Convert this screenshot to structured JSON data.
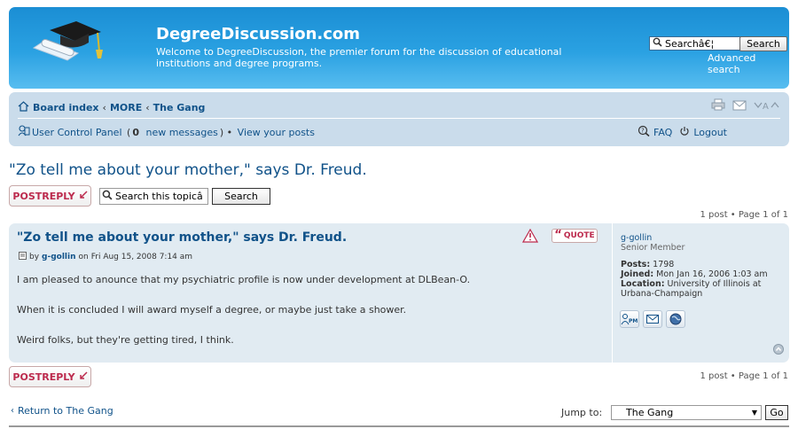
{
  "header": {
    "site_title": "DegreeDiscussion.com",
    "site_description": "Welcome to DegreeDiscussion, the premier forum for the discussion of educational institutions and degree programs.",
    "search_value": "Searchâ€¦",
    "search_button": "Search",
    "advanced_search": "Advanced search"
  },
  "navbar": {
    "breadcrumb": [
      "Board index",
      "MORE",
      "The Gang"
    ],
    "breadcrumb_sep": "‹",
    "ucp_label": "User Control Panel",
    "ucp_count": "0",
    "ucp_suffix": "new messages",
    "view_posts": "View your posts",
    "faq": "FAQ",
    "logout": "Logout"
  },
  "topic": {
    "title": "\"Zo tell me about your mother,\" says Dr. Freud.",
    "post_reply": "POSTREPLY",
    "search_placeholder": "Search this topicâ",
    "search_button": "Search",
    "pagination_top": "1 post • Page 1 of 1",
    "pagination_bottom": "1 post • Page 1 of 1"
  },
  "post": {
    "title": "\"Zo tell me about your mother,\" says Dr. Freud.",
    "by": "by",
    "author": "g-gollin",
    "on": "on",
    "date": "Fri Aug 15, 2008 7:14 am",
    "quote": "QUOTE",
    "body": [
      "I am pleased to anounce that my psychiatric profile is now under development at DLBean-O.",
      "When it is concluded I will award myself a degree, or maybe just take a shower.",
      "Weird folks, but they're getting tired, I think."
    ]
  },
  "profile": {
    "username": "g-gollin",
    "rank": "Senior Member",
    "posts_label": "Posts:",
    "posts": "1798",
    "joined_label": "Joined:",
    "joined": "Mon Jan 16, 2006 1:03 am",
    "location_label": "Location:",
    "location": "University of Illinois at Urbana-Champaign",
    "pm_label": "PM"
  },
  "footer": {
    "return_link": "Return to The Gang",
    "jump_label": "Jump to:",
    "jump_selected": "The Gang",
    "go_button": "Go"
  }
}
